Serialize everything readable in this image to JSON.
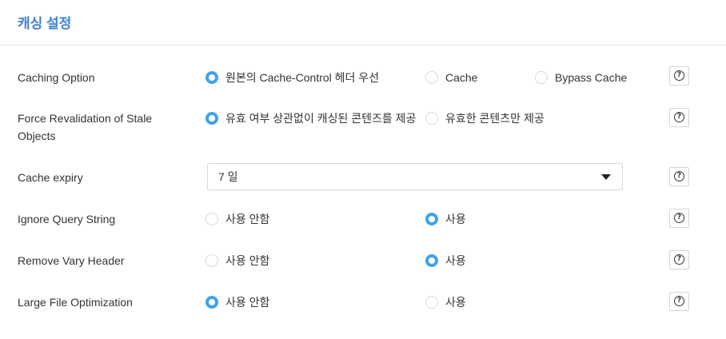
{
  "page": {
    "title": "캐싱 설정"
  },
  "accent_color": "#3ea3ec",
  "title_color": "#3b82d6",
  "help_icon": "question-circle-icon",
  "rows": [
    {
      "label": "Caching Option",
      "options": [
        {
          "label": "원본의 Cache-Control 헤더 우선",
          "checked": true
        },
        {
          "label": "Cache",
          "checked": false
        },
        {
          "label": "Bypass Cache",
          "checked": false
        }
      ]
    },
    {
      "label": "Force Revalidation of Stale Objects",
      "options": [
        {
          "label": "유효 여부 상관없이 캐싱된 콘텐즈를 제공",
          "checked": true
        },
        {
          "label": "유효한 콘텐츠만 제공",
          "checked": false
        }
      ]
    },
    {
      "label": "Cache expiry",
      "select": {
        "value": "7 일"
      }
    },
    {
      "label": "Ignore Query String",
      "options": [
        {
          "label": "사용 안함",
          "checked": false
        },
        {
          "label": "사용",
          "checked": true
        }
      ]
    },
    {
      "label": "Remove Vary Header",
      "options": [
        {
          "label": "사용 안함",
          "checked": false
        },
        {
          "label": "사용",
          "checked": true
        }
      ]
    },
    {
      "label": "Large File Optimization",
      "options": [
        {
          "label": "사용 안함",
          "checked": true
        },
        {
          "label": "사용",
          "checked": false
        }
      ]
    }
  ]
}
